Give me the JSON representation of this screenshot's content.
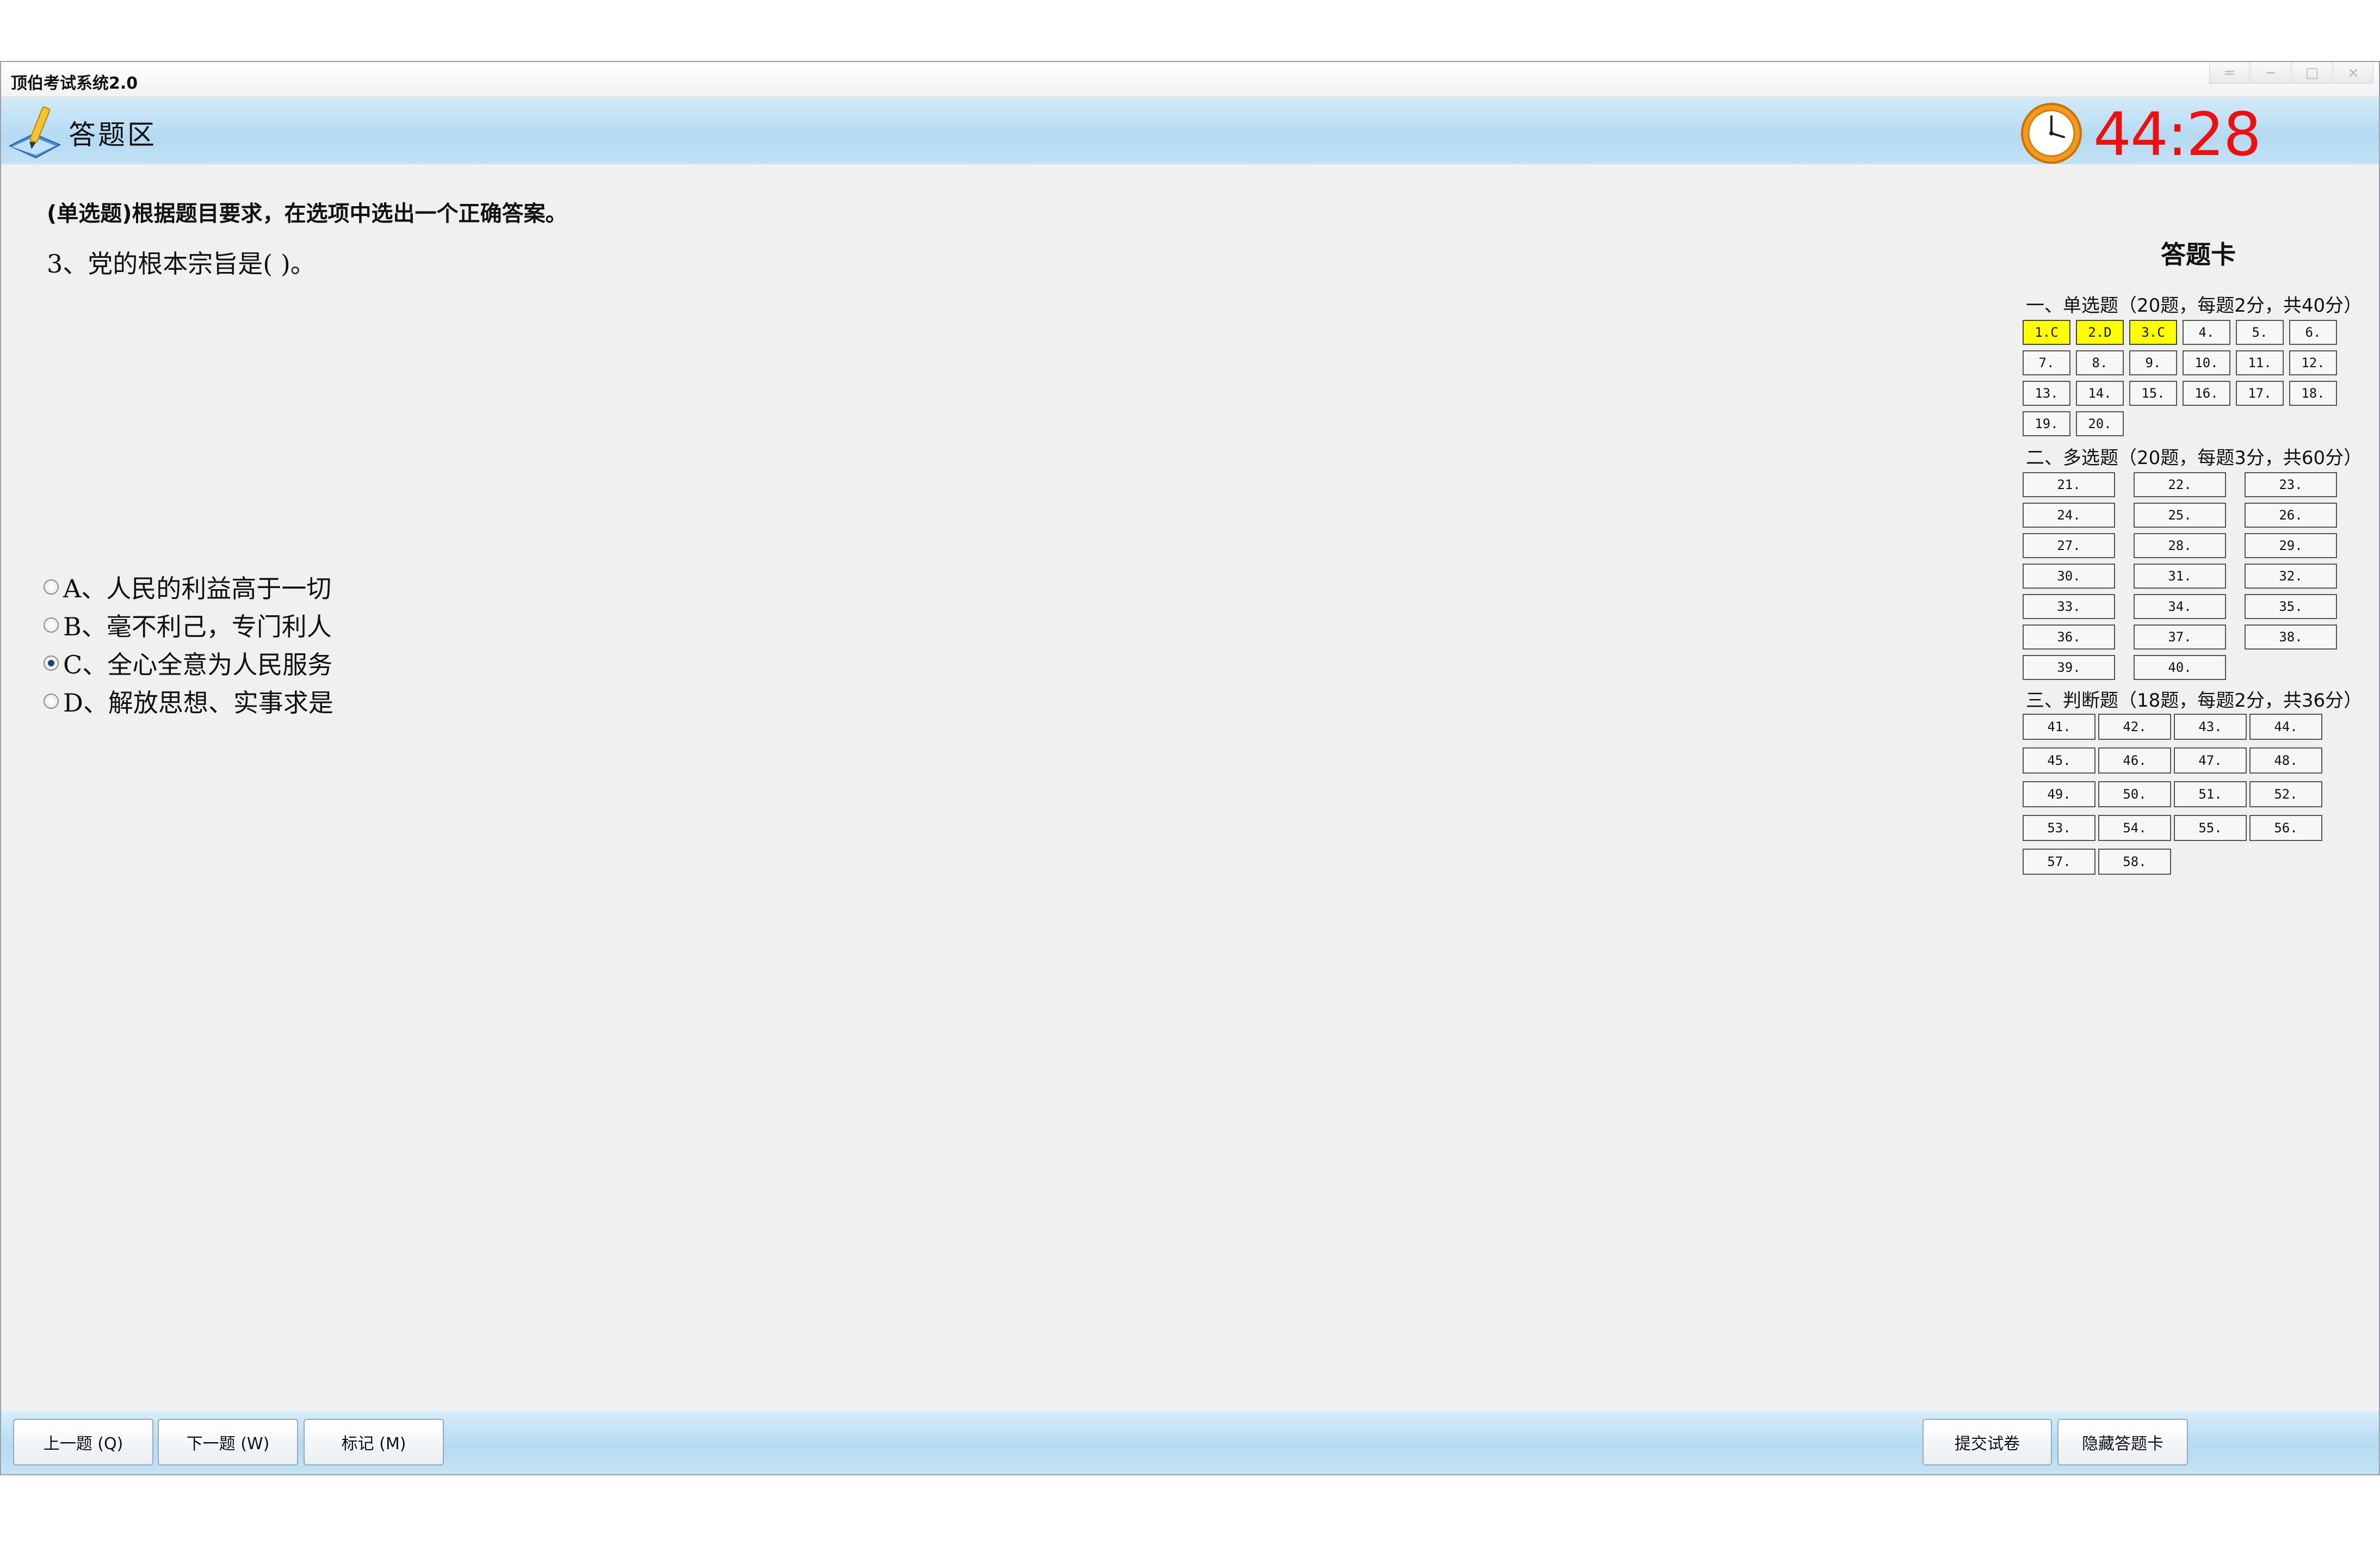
{
  "window": {
    "title": "顶伯考试系统2.0",
    "controls": [
      "=",
      "−",
      "□",
      "×"
    ]
  },
  "header": {
    "area_title": "答题区",
    "timer": "44:28",
    "icons": {
      "left": "pencil-book-icon",
      "timer": "clock-icon"
    }
  },
  "question": {
    "instruction": "(单选题)根据题目要求，在选项中选出一个正确答案。",
    "text": "3、党的根本宗旨是(    )。",
    "options": [
      {
        "label": "A、人民的利益高于一切",
        "checked": false
      },
      {
        "label": "B、毫不利己，专门利人",
        "checked": false
      },
      {
        "label": "C、全心全意为人民服务",
        "checked": true
      },
      {
        "label": "D、解放思想、实事求是",
        "checked": false
      }
    ]
  },
  "answer_card": {
    "title": "答题卡",
    "sections": [
      {
        "title": "一、单选题（20题，每题2分，共40分）",
        "items": [
          "1.C",
          "2.D",
          "3.C",
          "4.",
          "5.",
          "6.",
          "7.",
          "8.",
          "9.",
          "10.",
          "11.",
          "12.",
          "13.",
          "14.",
          "15.",
          "16.",
          "17.",
          "18.",
          "19.",
          "20."
        ],
        "answered": [
          true,
          true,
          true,
          false,
          false,
          false,
          false,
          false,
          false,
          false,
          false,
          false,
          false,
          false,
          false,
          false,
          false,
          false,
          false,
          false
        ]
      },
      {
        "title": "二、多选题（20题，每题3分，共60分）",
        "items": [
          "21.",
          "22.",
          "23.",
          "24.",
          "25.",
          "26.",
          "27.",
          "28.",
          "29.",
          "30.",
          "31.",
          "32.",
          "33.",
          "34.",
          "35.",
          "36.",
          "37.",
          "38.",
          "39.",
          "40."
        ]
      },
      {
        "title": "三、判断题（18题，每题2分，共36分）",
        "items": [
          "41.",
          "42.",
          "43.",
          "44.",
          "45.",
          "46.",
          "47.",
          "48.",
          "49.",
          "50.",
          "51.",
          "52.",
          "53.",
          "54.",
          "55.",
          "56.",
          "57.",
          "58."
        ]
      }
    ],
    "highlight_color": "#ffff00"
  },
  "footer": {
    "prev": "上一题 (Q)",
    "next": "下一题 (W)",
    "mark": "标记 (M)",
    "submit": "提交试卷",
    "hide_card": "隐藏答题卡"
  },
  "colors": {
    "timer": "#ee1010",
    "header_band": "#b3daf2"
  }
}
